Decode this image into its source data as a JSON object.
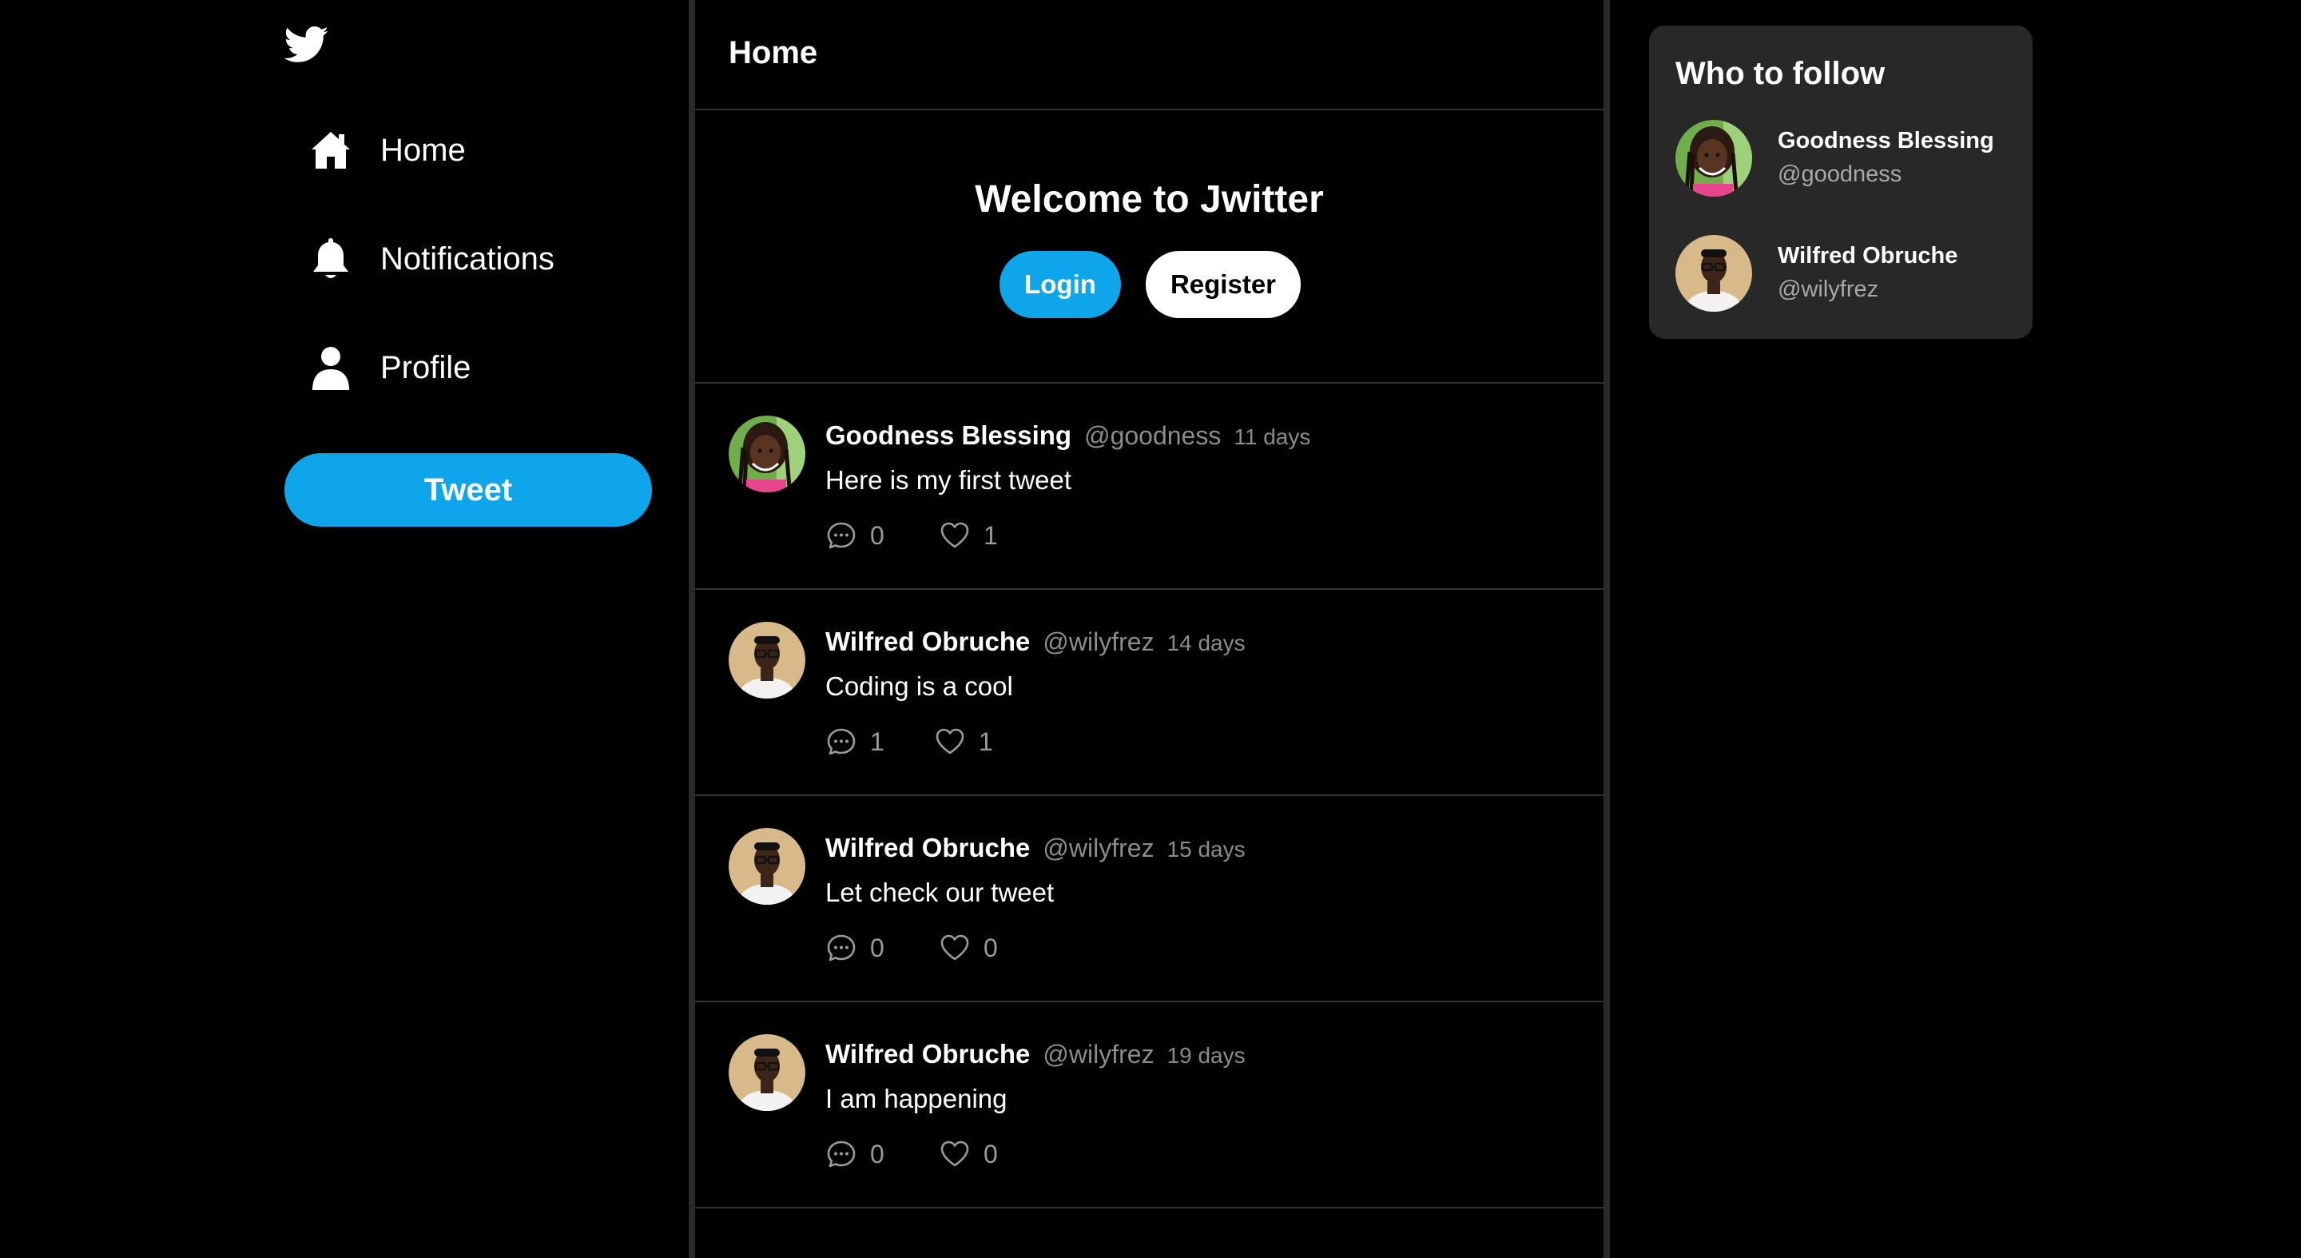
{
  "sidebar": {
    "logo_icon": "twitter-bird-icon",
    "items": [
      {
        "label": "Home",
        "icon": "home-icon"
      },
      {
        "label": "Notifications",
        "icon": "bell-icon"
      },
      {
        "label": "Profile",
        "icon": "user-icon"
      }
    ],
    "tweet_label": "Tweet"
  },
  "header": {
    "title": "Home"
  },
  "welcome": {
    "title": "Welcome to Jwitter",
    "login_label": "Login",
    "register_label": "Register"
  },
  "tweets": [
    {
      "name": "Goodness Blessing",
      "handle": "@goodness",
      "time": "11 days",
      "text": "Here is my first tweet",
      "replies": "0",
      "likes": "1",
      "avatar": "goodness"
    },
    {
      "name": "Wilfred Obruche",
      "handle": "@wilyfrez",
      "time": "14 days",
      "text": "Coding is a cool",
      "replies": "1",
      "likes": "1",
      "avatar": "wilfred"
    },
    {
      "name": "Wilfred Obruche",
      "handle": "@wilyfrez",
      "time": "15 days",
      "text": "Let check our tweet",
      "replies": "0",
      "likes": "0",
      "avatar": "wilfred"
    },
    {
      "name": "Wilfred Obruche",
      "handle": "@wilyfrez",
      "time": "19 days",
      "text": "I am happening",
      "replies": "0",
      "likes": "0",
      "avatar": "wilfred"
    }
  ],
  "who_to_follow": {
    "title": "Who to follow",
    "users": [
      {
        "name": "Goodness Blessing",
        "handle": "@goodness",
        "avatar": "goodness"
      },
      {
        "name": "Wilfred Obruche",
        "handle": "@wilyfrez",
        "avatar": "wilfred"
      }
    ]
  },
  "colors": {
    "accent": "#0fa5ea",
    "background": "#000000",
    "card": "#282828",
    "muted_text": "#8b8b8b"
  }
}
